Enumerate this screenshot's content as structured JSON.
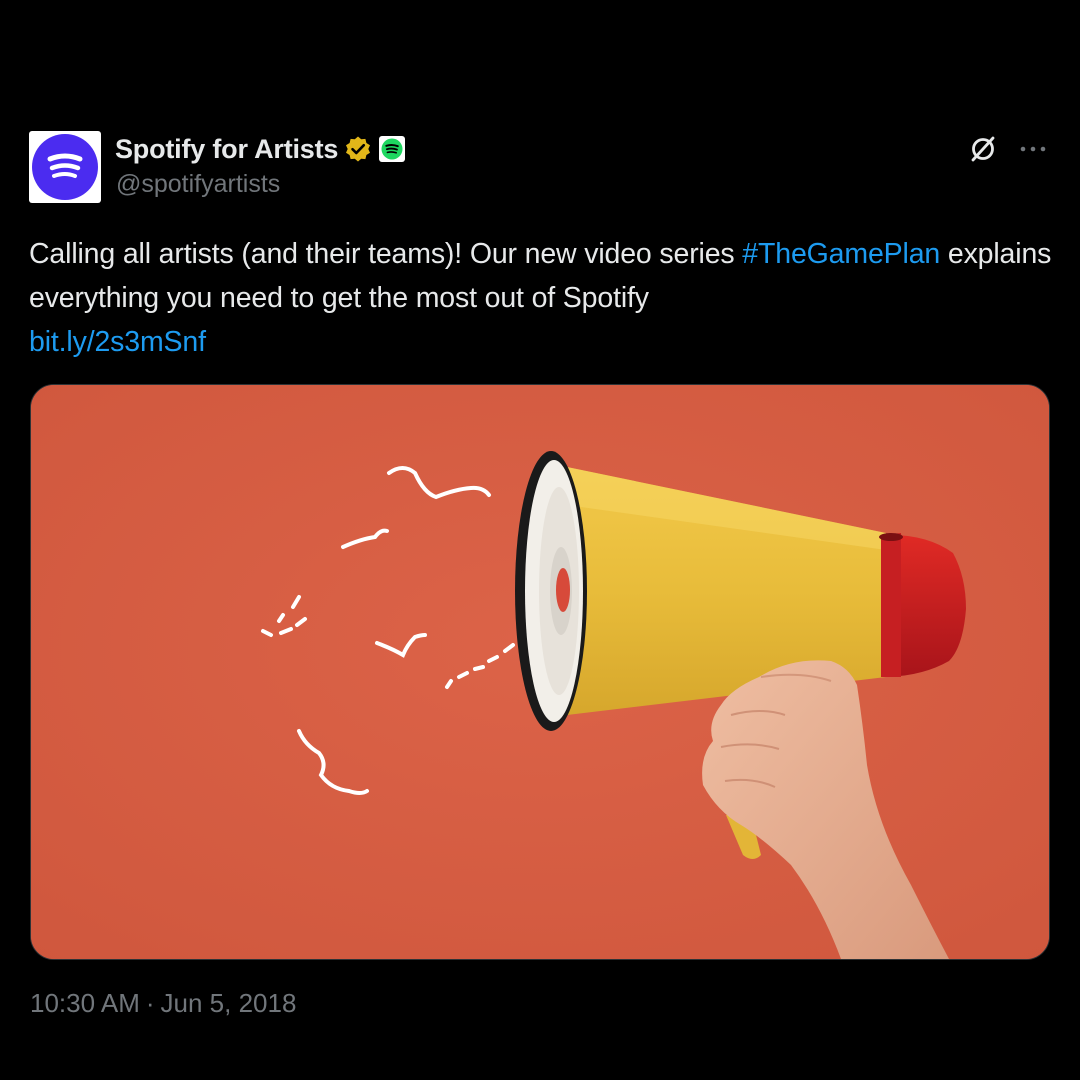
{
  "account": {
    "display_name": "Spotify for Artists",
    "handle": "@spotifyartists",
    "avatar_icon": "spotify-logo-icon",
    "verified_icon": "verified-badge-icon",
    "affiliate_icon": "spotify-affiliate-icon"
  },
  "actions": {
    "grok_icon": "grok-icon",
    "more_icon": "more-options-icon"
  },
  "tweet": {
    "text_part1": "Calling all artists (and their teams)! Our new video series ",
    "hashtag": "#TheGamePlan",
    "text_part2": " explains everything you need to get the most out of Spotify ",
    "link": "bit.ly/2s3mSnf"
  },
  "media": {
    "description_icon": "megaphone-photo",
    "background_color": "#d75c42"
  },
  "meta": {
    "time": "10:30 AM",
    "separator": "·",
    "date": "Jun 5, 2018"
  },
  "colors": {
    "background": "#000000",
    "text": "#e7e9ea",
    "secondary": "#71767b",
    "link": "#1d9bf0",
    "avatar_purple": "#4b2cf0",
    "verified_gold": "#e2b719",
    "spotify_green": "#1ed760"
  }
}
